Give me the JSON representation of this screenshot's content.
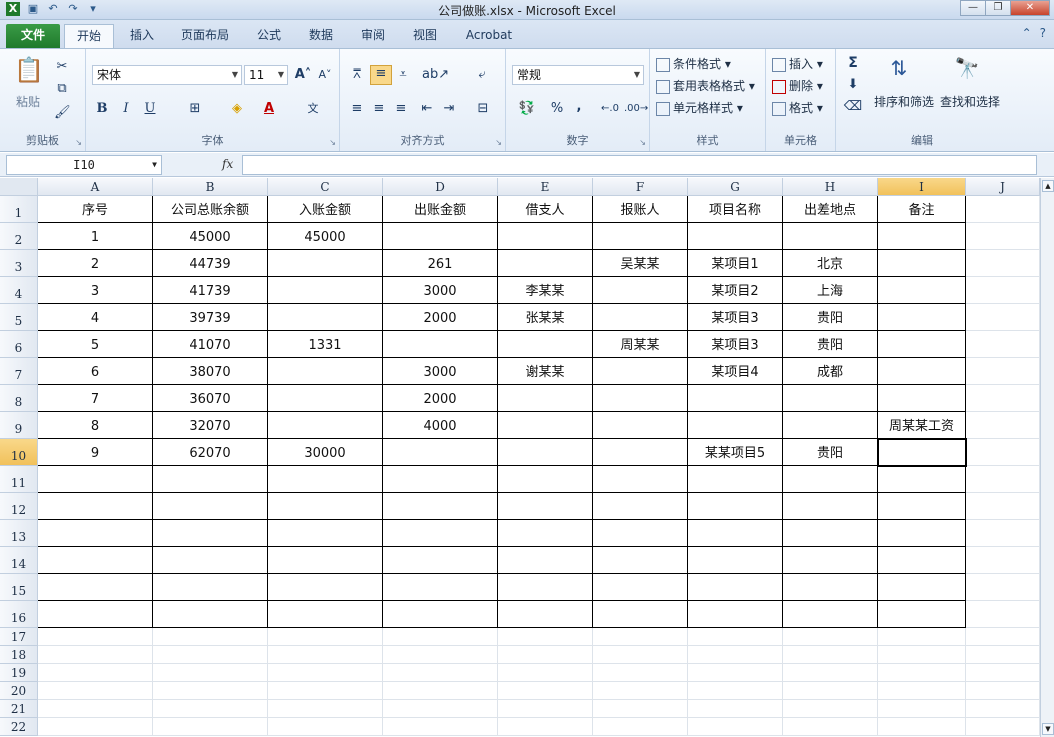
{
  "window": {
    "title": "公司做账.xlsx  -  Microsoft Excel"
  },
  "tabs": [
    "文件",
    "开始",
    "插入",
    "页面布局",
    "公式",
    "数据",
    "审阅",
    "视图",
    "Acrobat"
  ],
  "ribbon": {
    "clipboard": {
      "paste": "粘贴",
      "label": "剪贴板"
    },
    "font": {
      "name": "宋体",
      "size": "11",
      "bold": "B",
      "italic": "I",
      "underline": "U",
      "label": "字体"
    },
    "alignment": {
      "label": "对齐方式"
    },
    "number": {
      "format": "常规",
      "percent": "%",
      "comma": ",",
      "label": "数字"
    },
    "styles": {
      "conditional": "条件格式",
      "table": "套用表格格式",
      "cell": "单元格样式",
      "label": "样式"
    },
    "cells": {
      "insert": "插入",
      "delete": "删除",
      "format": "格式",
      "label": "单元格"
    },
    "editing": {
      "sum": "Σ",
      "sort": "排序和筛选",
      "find": "查找和选择",
      "label": "编辑"
    }
  },
  "formula_bar": {
    "name_box": "I10",
    "fx": "fx",
    "value": ""
  },
  "columns": [
    "A",
    "B",
    "C",
    "D",
    "E",
    "F",
    "G",
    "H",
    "I",
    "J"
  ],
  "selected_cell": "I10",
  "rows": [
    [
      "序号",
      "公司总账余额",
      "入账金额",
      "出账金额",
      "借支人",
      "报账人",
      "项目名称",
      "出差地点",
      "备注"
    ],
    [
      "1",
      "45000",
      "45000",
      "",
      "",
      "",
      "",
      "",
      ""
    ],
    [
      "2",
      "44739",
      "",
      "261",
      "",
      "吴某某",
      "某项目1",
      "北京",
      ""
    ],
    [
      "3",
      "41739",
      "",
      "3000",
      "李某某",
      "",
      "某项目2",
      "上海",
      ""
    ],
    [
      "4",
      "39739",
      "",
      "2000",
      "张某某",
      "",
      "某项目3",
      "贵阳",
      ""
    ],
    [
      "5",
      "41070",
      "1331",
      "",
      "",
      "周某某",
      "某项目3",
      "贵阳",
      ""
    ],
    [
      "6",
      "38070",
      "",
      "3000",
      "谢某某",
      "",
      "某项目4",
      "成都",
      ""
    ],
    [
      "7",
      "36070",
      "",
      "2000",
      "",
      "",
      "",
      "",
      ""
    ],
    [
      "8",
      "32070",
      "",
      "4000",
      "",
      "",
      "",
      "",
      "周某某工资"
    ],
    [
      "9",
      "62070",
      "30000",
      "",
      "",
      "",
      "某某项目5",
      "贵阳",
      ""
    ],
    [
      "",
      "",
      "",
      "",
      "",
      "",
      "",
      "",
      ""
    ],
    [
      "",
      "",
      "",
      "",
      "",
      "",
      "",
      "",
      ""
    ],
    [
      "",
      "",
      "",
      "",
      "",
      "",
      "",
      "",
      ""
    ],
    [
      "",
      "",
      "",
      "",
      "",
      "",
      "",
      "",
      ""
    ],
    [
      "",
      "",
      "",
      "",
      "",
      "",
      "",
      "",
      ""
    ],
    [
      "",
      "",
      "",
      "",
      "",
      "",
      "",
      "",
      ""
    ]
  ],
  "row_numbers": [
    "1",
    "2",
    "3",
    "4",
    "5",
    "6",
    "7",
    "8",
    "9",
    "10",
    "11",
    "12",
    "13",
    "14",
    "15",
    "16",
    "17",
    "18",
    "19",
    "20",
    "21",
    "22"
  ]
}
